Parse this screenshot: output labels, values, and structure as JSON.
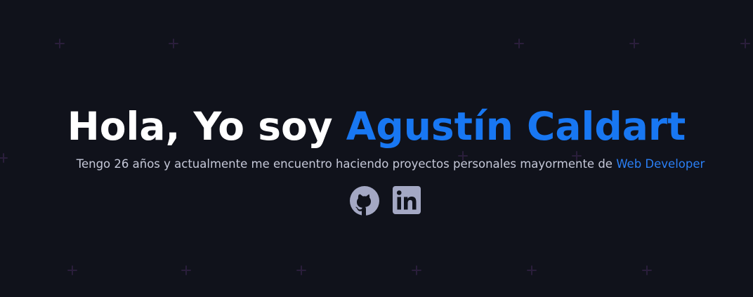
{
  "hero": {
    "greeting": "Hola, Yo soy",
    "name": "Agustín Caldart",
    "tagline_prefix": "Tengo 26 años y actualmente me encuentro haciendo proyectos personales mayormente de",
    "tagline_highlight": "Web Developer"
  },
  "socials": [
    {
      "icon": "github-icon"
    },
    {
      "icon": "linkedin-icon"
    }
  ],
  "colors": {
    "background": "#10121b",
    "accent": "#1877f2",
    "text": "#ffffff",
    "muted_text": "#c5c8d8",
    "icon": "#a4a8c4",
    "pattern": "#2b1f3a"
  }
}
